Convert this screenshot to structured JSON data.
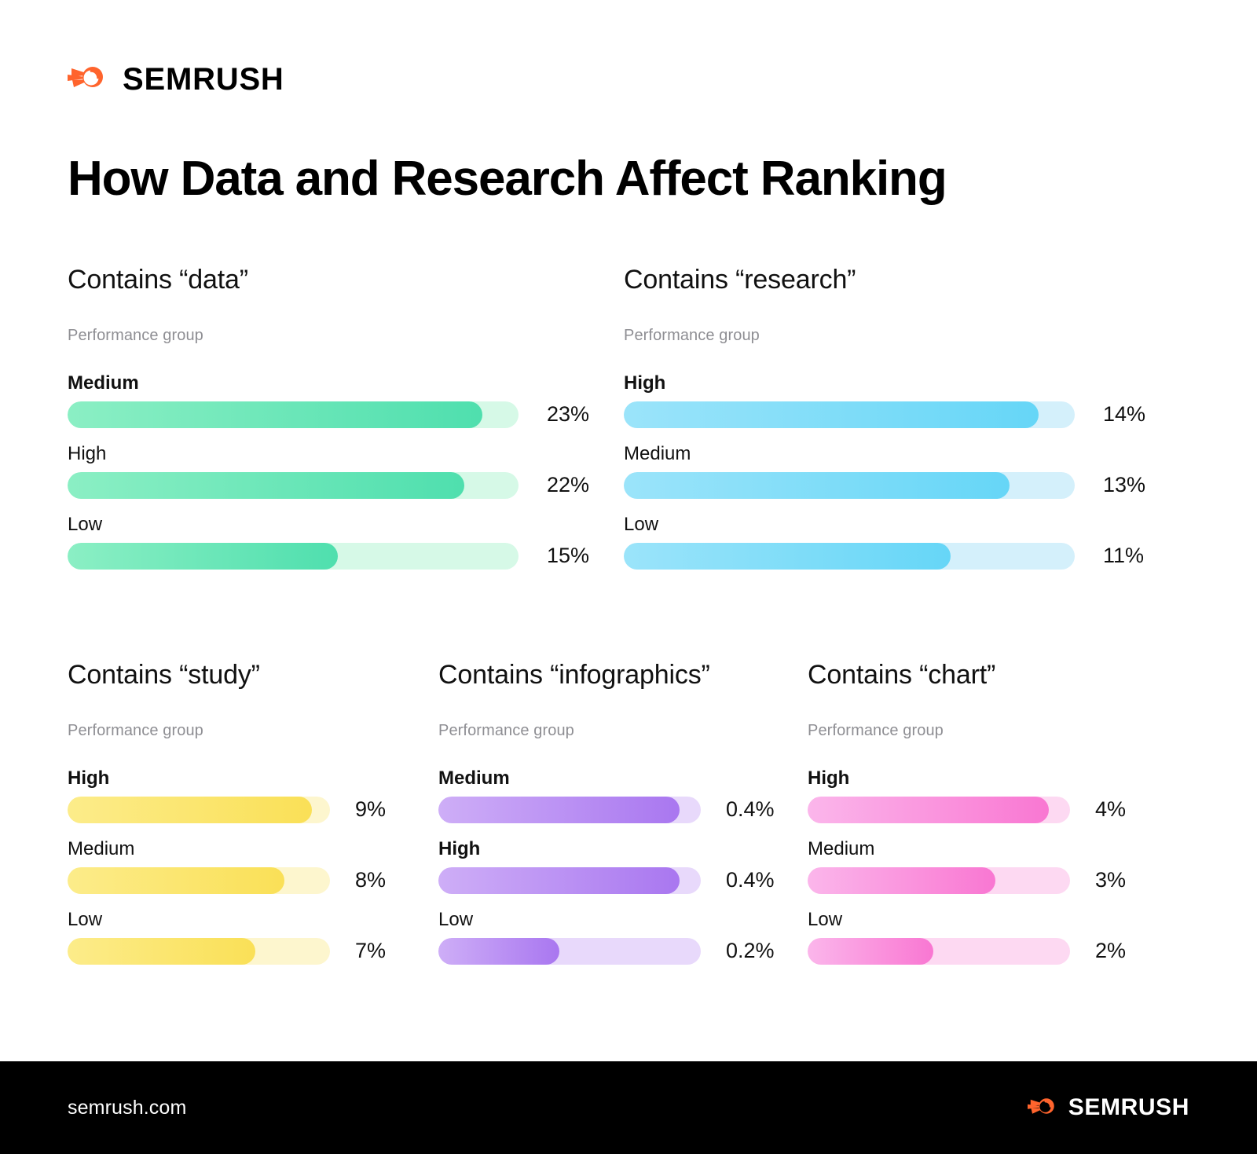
{
  "header": {
    "brand": "SEMRUSH",
    "logo_icon": "semrush-comet-icon",
    "brand_color": "#FF642D"
  },
  "title": "How Data and Research Affect Ranking",
  "footer": {
    "url": "semrush.com",
    "brand": "SEMRUSH",
    "logo_icon": "semrush-comet-icon",
    "background": "#000000"
  },
  "common": {
    "subtitle": "Performance group"
  },
  "chart_data": [
    {
      "type": "bar",
      "title": "Contains “data”",
      "subtitle": "Performance group",
      "orientation": "horizontal",
      "categories": [
        "Medium",
        "High",
        "Low"
      ],
      "values": [
        23,
        22,
        15
      ],
      "value_labels": [
        "23%",
        "22%",
        "15%"
      ],
      "fill_ratios": [
        0.92,
        0.88,
        0.6
      ],
      "color_start": "#8BEFC4",
      "color_end": "#4FDFAE",
      "track_color": "#D6F9E7",
      "xlabel": "",
      "ylabel": "",
      "grid": false,
      "legend": "none"
    },
    {
      "type": "bar",
      "title": "Contains “research”",
      "subtitle": "Performance group",
      "orientation": "horizontal",
      "categories": [
        "High",
        "Medium",
        "Low"
      ],
      "values": [
        14,
        13,
        11
      ],
      "value_labels": [
        "14%",
        "13%",
        "11%"
      ],
      "fill_ratios": [
        0.92,
        0.855,
        0.725
      ],
      "color_start": "#9BE4FA",
      "color_end": "#66D6F7",
      "track_color": "#D4F0FB",
      "xlabel": "",
      "ylabel": "",
      "grid": false,
      "legend": "none"
    },
    {
      "type": "bar",
      "title": "Contains “study”",
      "subtitle": "Performance group",
      "orientation": "horizontal",
      "categories": [
        "High",
        "Medium",
        "Low"
      ],
      "values": [
        9,
        8,
        7
      ],
      "value_labels": [
        "9%",
        "8%",
        "7%"
      ],
      "fill_ratios": [
        0.93,
        0.825,
        0.715
      ],
      "color_start": "#FCEC8A",
      "color_end": "#FAE057",
      "track_color": "#FDF6CE",
      "xlabel": "",
      "ylabel": "",
      "grid": false,
      "legend": "none"
    },
    {
      "type": "bar",
      "title": "Contains “infographics”",
      "subtitle": "Performance group",
      "orientation": "horizontal",
      "categories": [
        "Medium",
        "High",
        "Low"
      ],
      "values": [
        0.4,
        0.4,
        0.2
      ],
      "value_labels": [
        "0.4%",
        "0.4%",
        "0.2%"
      ],
      "fill_ratios": [
        0.92,
        0.92,
        0.46
      ],
      "color_start": "#CEAEF7",
      "color_end": "#A977F0",
      "track_color": "#E8D9FB",
      "xlabel": "",
      "ylabel": "",
      "grid": false,
      "legend": "none"
    },
    {
      "type": "bar",
      "title": "Contains “chart”",
      "subtitle": "Performance group",
      "orientation": "horizontal",
      "categories": [
        "High",
        "Medium",
        "Low"
      ],
      "values": [
        4,
        3,
        2
      ],
      "value_labels": [
        "4%",
        "3%",
        "2%"
      ],
      "fill_ratios": [
        0.92,
        0.715,
        0.48
      ],
      "color_start": "#FBB6EB",
      "color_end": "#F977D2",
      "track_color": "#FDD9F2",
      "xlabel": "",
      "ylabel": "",
      "grid": false,
      "legend": "none"
    }
  ]
}
